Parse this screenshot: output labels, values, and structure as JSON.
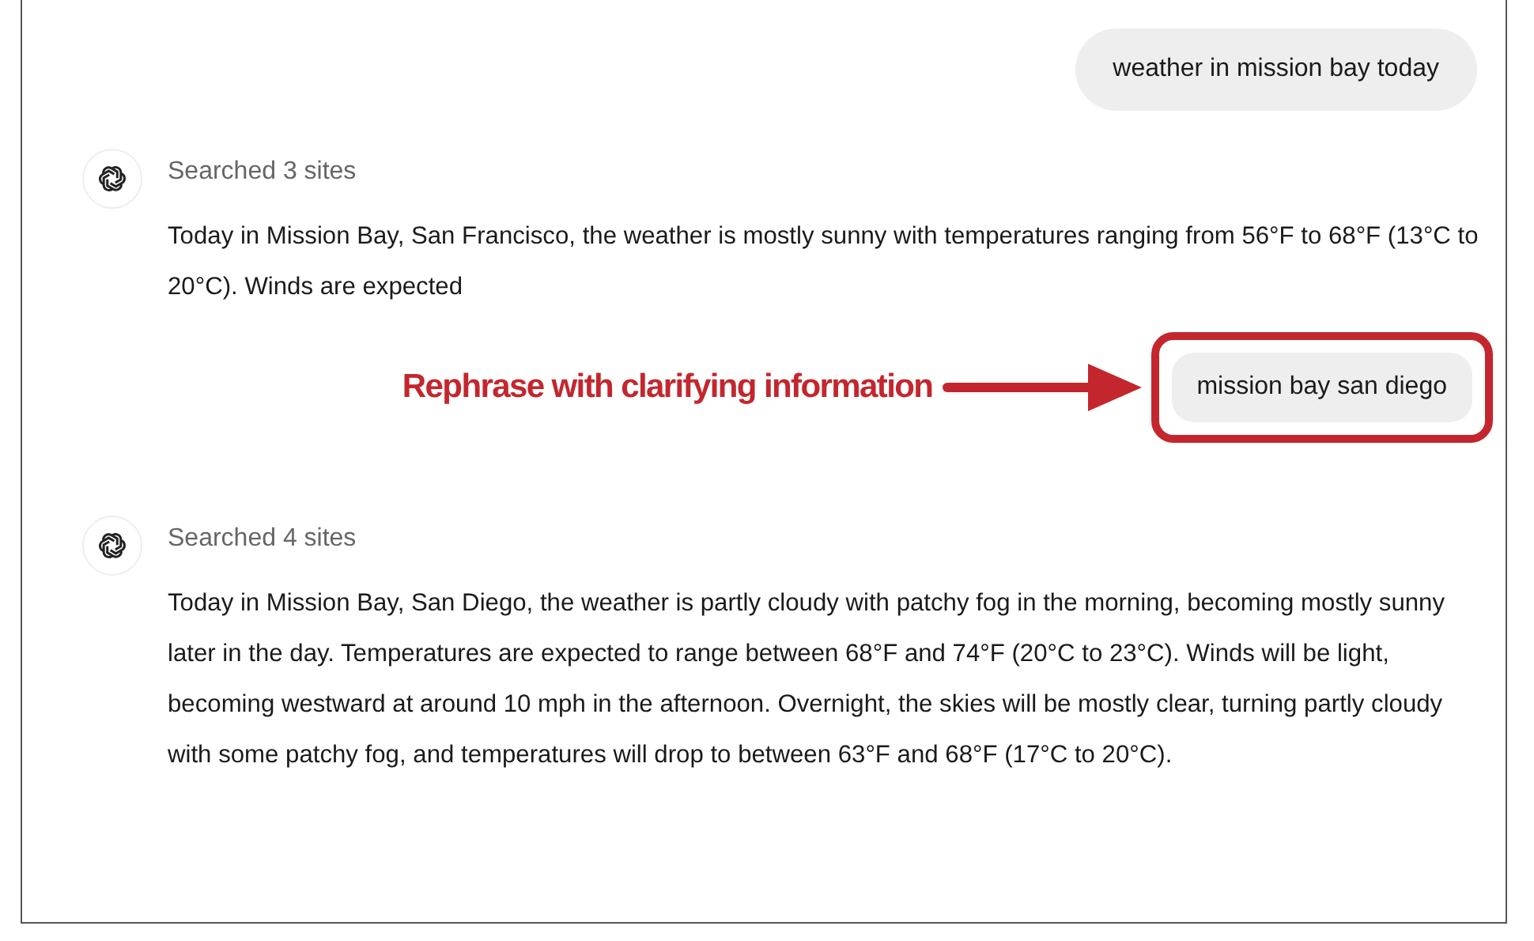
{
  "messages": [
    {
      "kind": "user",
      "text": "weather in mission bay today"
    },
    {
      "kind": "assistant",
      "status": "Searched 3 sites",
      "text": "Today in Mission Bay, San Francisco, the weather is mostly sunny with temperatures ranging from 56°F to 68°F (13°C to 20°C). Winds are expected"
    },
    {
      "kind": "user",
      "text": "mission bay san diego",
      "callout": "Rephrase with clarifying information"
    },
    {
      "kind": "assistant",
      "status": "Searched 4 sites",
      "text": "Today in Mission Bay, San Diego, the weather is partly cloudy with patchy fog in the morning, becoming mostly sunny later in the day. Temperatures are expected to range between 68°F and 74°F (20°C to 23°C). Winds will be light, becoming westward at around 10 mph in the afternoon. Overnight, the skies will be mostly clear, turning partly cloudy with some patchy fog, and temperatures will drop to between 63°F and 68°F (17°C to 20°C)."
    }
  ]
}
